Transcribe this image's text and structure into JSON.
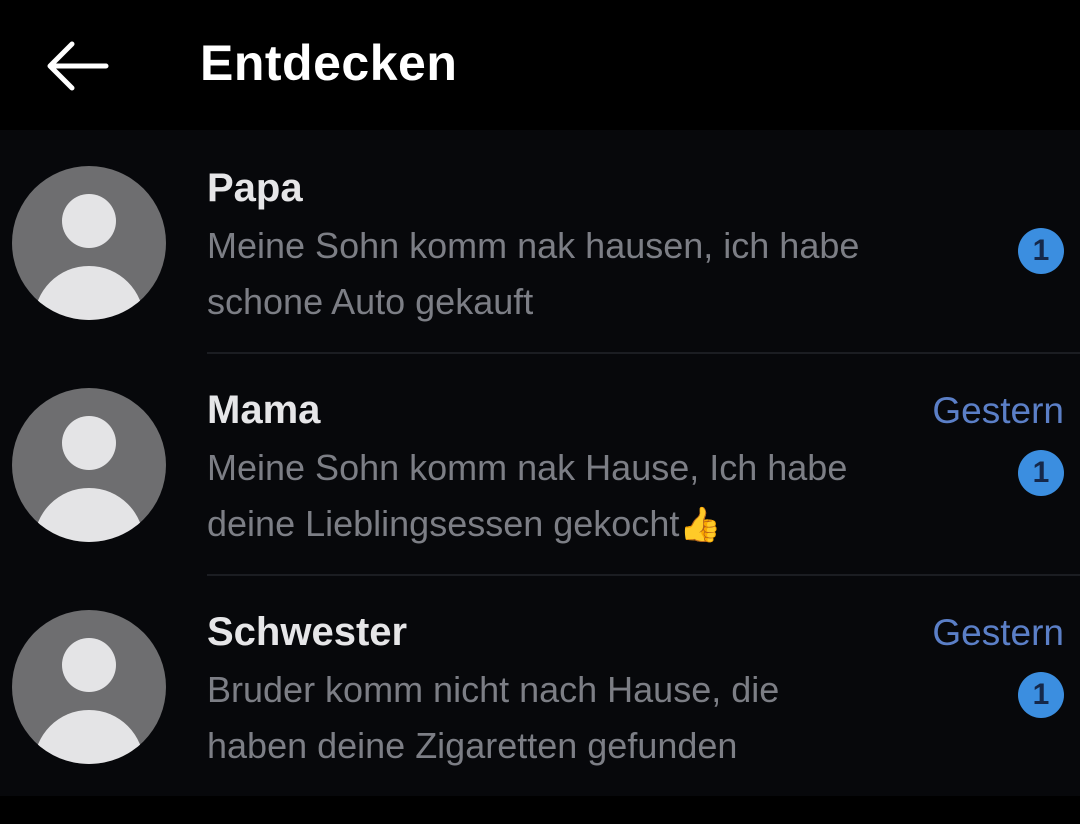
{
  "header": {
    "back_icon": "arrow-left-icon",
    "title": "Entdecken"
  },
  "chats": [
    {
      "name": "Papa",
      "time": "",
      "message_line1": "Meine Sohn komm nak hausen, ich habe",
      "message_line2": "schone Auto gekauft",
      "unread": "1"
    },
    {
      "name": "Mama",
      "time": "Gestern",
      "message_line1": "Meine Sohn komm nak Hause, Ich habe",
      "message_line2": "deine Lieblingsessen gekocht",
      "message_emoji": "👍",
      "unread": "1"
    },
    {
      "name": "Schwester",
      "time": "Gestern",
      "message_line1": "Bruder komm nicht nach Hause, die",
      "message_line2": "haben deine Zigaretten gefunden",
      "unread": "1"
    }
  ],
  "colors": {
    "background": "#000000",
    "accent_time": "#5b7fc7",
    "badge": "#3b8ee0",
    "avatar": "#6e6e70"
  }
}
